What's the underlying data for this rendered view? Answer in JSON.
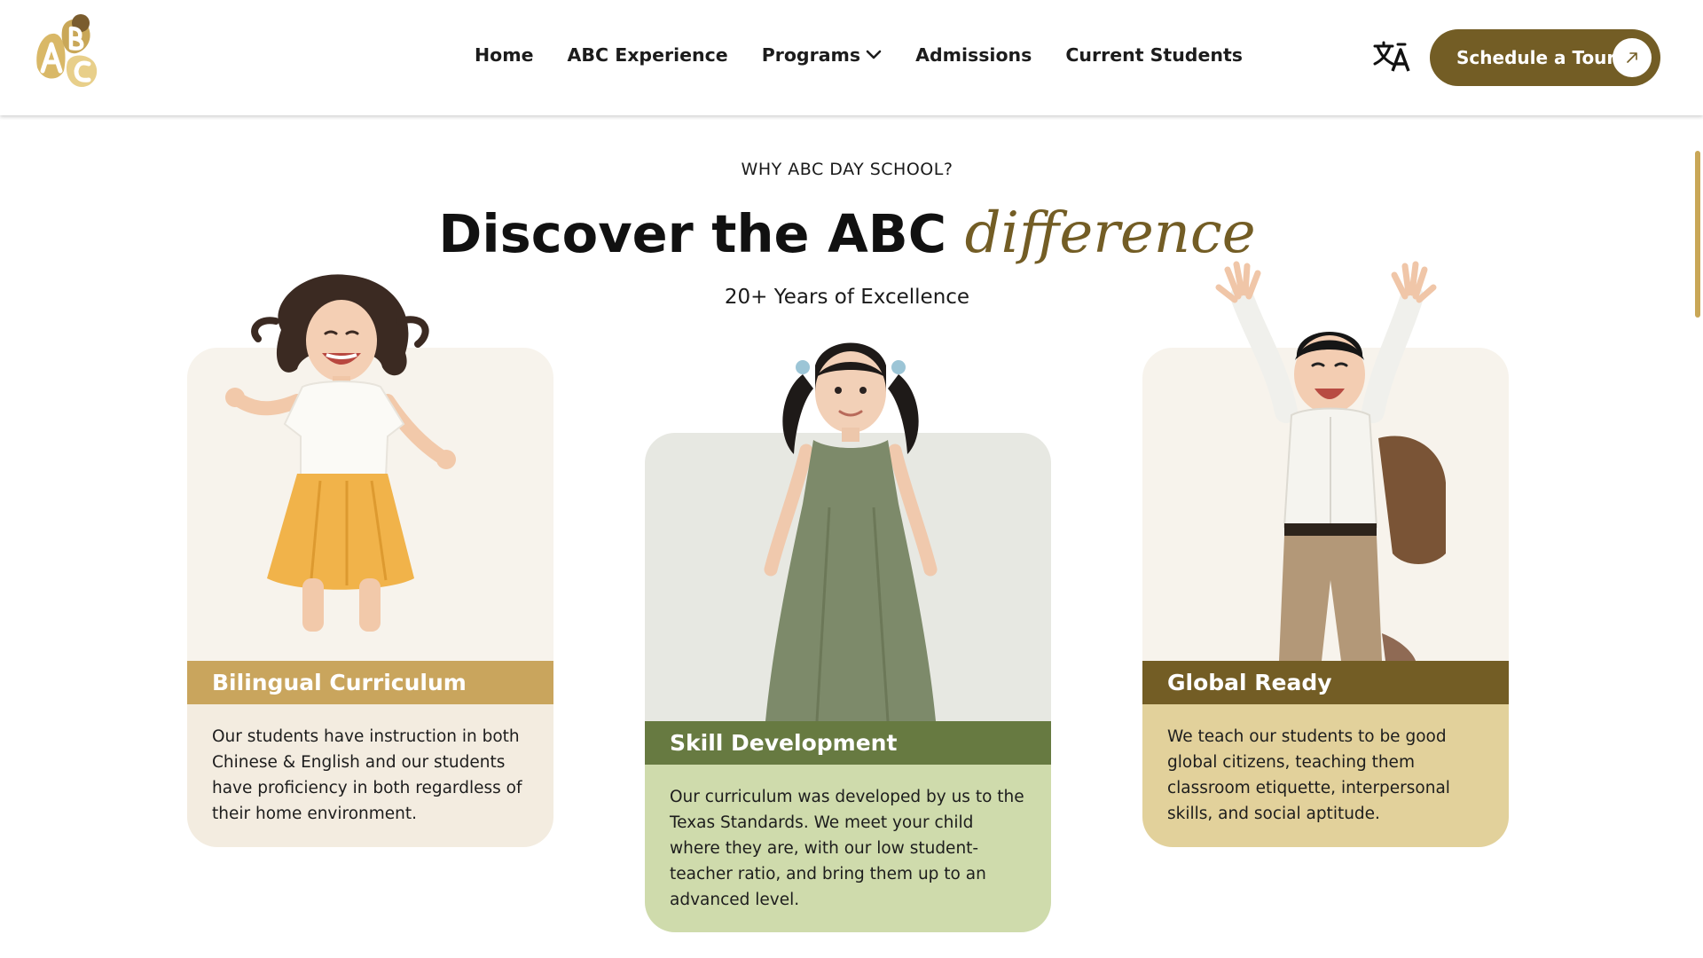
{
  "header": {
    "logo_text": "ABC",
    "nav": [
      {
        "label": "Home"
      },
      {
        "label": "ABC Experience"
      },
      {
        "label": "Programs",
        "has_dropdown": true
      },
      {
        "label": "Admissions"
      },
      {
        "label": "Current Students"
      }
    ],
    "translate_icon": "translate-icon",
    "cta_label": "Schedule a Tour",
    "cta_icon": "arrow-up-right-icon"
  },
  "intro": {
    "eyebrow": "WHY ABC DAY SCHOOL?",
    "headline_main": "Discover the ABC",
    "headline_accent": "difference",
    "subline": "20+ Years of Excellence"
  },
  "cards": [
    {
      "title": "Bilingual Curriculum",
      "text": "Our students have instruction in both Chinese & English and our students have proficiency in both regardless of their home environment.",
      "band_color": "#c9a55d",
      "body_color": "#f3ece0",
      "photo": "girl-jumping-yellow-skirt"
    },
    {
      "title": "Skill Development",
      "text": "Our curriculum was developed by us to the Texas Standards. We meet your child where they are, with our low student-teacher ratio, and bring them up to an advanced level.",
      "band_color": "#677a41",
      "body_color": "#cfdbac",
      "photo": "girl-pigtails-green-dress"
    },
    {
      "title": "Global Ready",
      "text": "We teach our students to be good global citizens, teaching them classroom etiquette, interpersonal skills, and social aptitude.",
      "band_color": "#735d25",
      "body_color": "#e2d19b",
      "photo": "boy-jumping-backpack"
    }
  ],
  "colors": {
    "brand_brown": "#735d25",
    "brand_gold": "#c9a757",
    "brand_green": "#677a41"
  }
}
